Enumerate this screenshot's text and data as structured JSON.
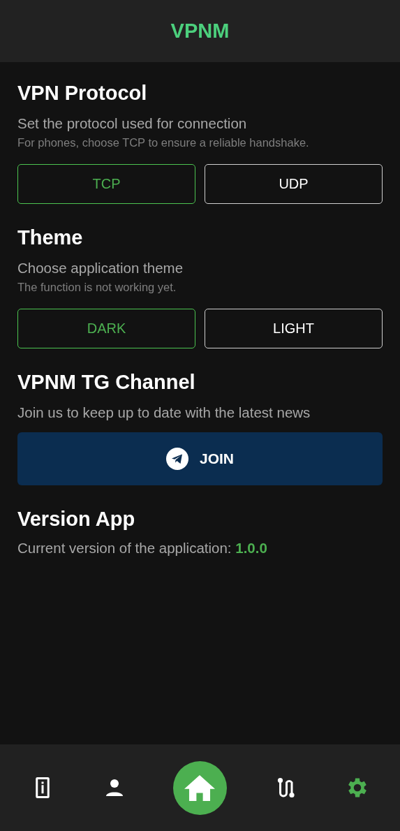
{
  "header": {
    "title": "VPNM"
  },
  "protocol": {
    "title": "VPN Protocol",
    "subtitle": "Set the protocol used for connection",
    "hint": "For phones, choose TCP to ensure a reliable handshake.",
    "options": [
      {
        "label": "TCP",
        "selected": true
      },
      {
        "label": "UDP",
        "selected": false
      }
    ]
  },
  "theme": {
    "title": "Theme",
    "subtitle": "Choose application theme",
    "hint": "The function is not working yet.",
    "options": [
      {
        "label": "DARK",
        "selected": true
      },
      {
        "label": "LIGHT",
        "selected": false
      }
    ]
  },
  "channel": {
    "title": "VPNM TG Channel",
    "subtitle": "Join us to keep up to date with the latest news",
    "button": "JOIN"
  },
  "version": {
    "title": "Version App",
    "label": "Current version of the application:",
    "value": "1.0.0"
  },
  "nav": [
    {
      "kind": "info",
      "selected": false
    },
    {
      "kind": "profile",
      "selected": false
    },
    {
      "kind": "home"
    },
    {
      "kind": "route",
      "selected": false
    },
    {
      "kind": "settings",
      "selected": true
    }
  ]
}
